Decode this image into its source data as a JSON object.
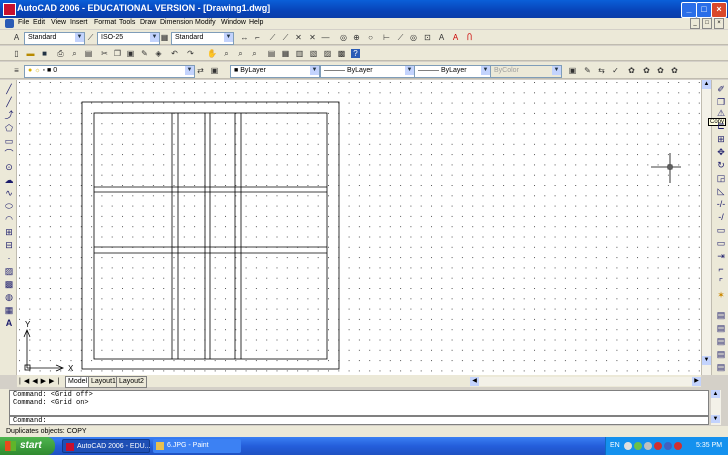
{
  "window": {
    "title": "AutoCAD 2006 - EDUCATIONAL VERSION - [Drawing1.dwg]"
  },
  "menu": [
    "File",
    "Edit",
    "View",
    "Insert",
    "Format",
    "Tools",
    "Draw",
    "Dimension",
    "Modify",
    "Window",
    "Help"
  ],
  "toolbar_styles": {
    "text_style": "Standard",
    "dim_style": "ISO-25",
    "table_style": "Standard"
  },
  "toolbar_layers": {
    "layer": "0",
    "color": "ByLayer",
    "linetype": "ByLayer",
    "lineweight": "ByLayer",
    "plotstyle": "ByColor"
  },
  "tabs": [
    "Model",
    "Layout1",
    "Layout2"
  ],
  "tooltip": "Copy",
  "ucs": {
    "x": "X",
    "y": "Y"
  },
  "command_history": [
    "Command:  <Grid off>",
    "Command:  <Grid on>"
  ],
  "command_prompt": "Command:",
  "status_text": "Duplicates objects:  COPY",
  "taskbar": {
    "start": "start",
    "items": [
      "AutoCAD 2006 - EDU...",
      "6.JPG - Paint"
    ],
    "lang": "EN",
    "time": "5:35 PM"
  },
  "colors": {
    "accent": "#0a5fd8",
    "taskbar": "#245edb",
    "start": "#2f8a2f"
  }
}
